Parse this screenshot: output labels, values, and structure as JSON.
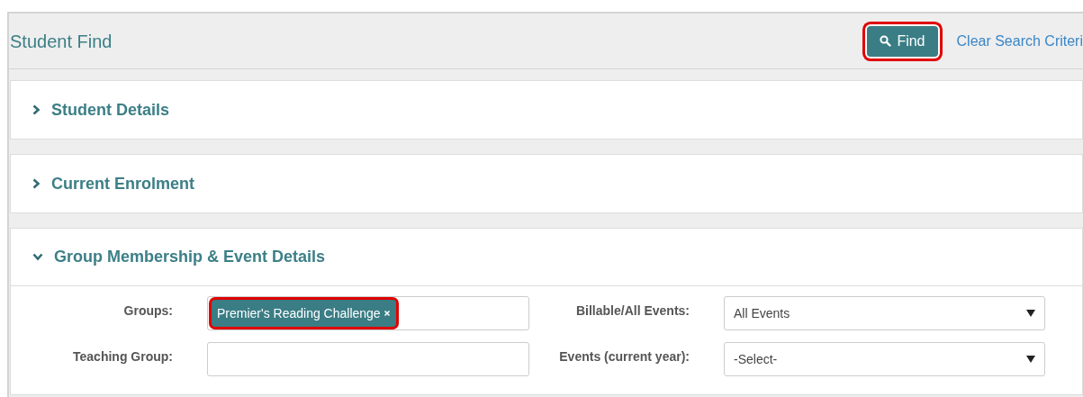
{
  "header": {
    "title": "Student Find",
    "find_button": {
      "label": "Find",
      "highlighted": true
    },
    "clear_link": "Clear Search Criteri"
  },
  "sections": [
    {
      "title": "Student Details",
      "expanded": false
    },
    {
      "title": "Current Enrolment",
      "expanded": false
    },
    {
      "title": "Group Membership & Event Details",
      "expanded": true,
      "fields": [
        {
          "kind": "tags",
          "label": "Groups:",
          "tags": [
            {
              "label": "Premier's Reading Challenge",
              "highlighted": true
            }
          ]
        },
        {
          "kind": "select",
          "label": "Billable/All Events:",
          "value": "All Events"
        },
        {
          "kind": "text",
          "label": "Teaching Group:"
        },
        {
          "kind": "select",
          "label": "Events (current year):",
          "value": "-Select-"
        }
      ]
    }
  ]
}
